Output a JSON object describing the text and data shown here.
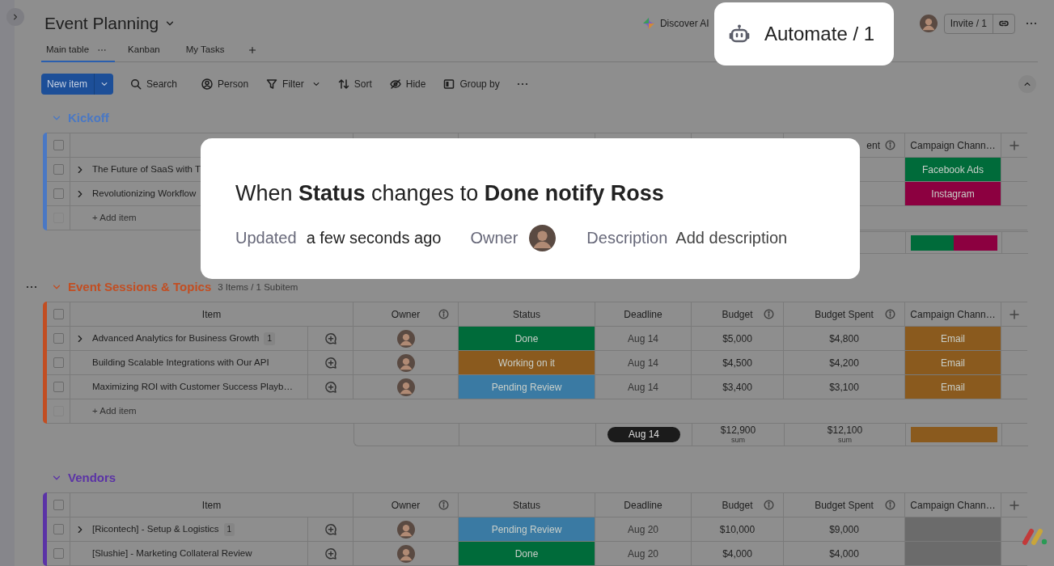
{
  "board": {
    "title": "Event Planning"
  },
  "views": [
    {
      "label": "Main table",
      "selected": true
    },
    {
      "label": "Kanban",
      "selected": false
    },
    {
      "label": "My Tasks",
      "selected": false
    }
  ],
  "header_actions": {
    "discover_ai": "Discover AI",
    "automate": "Automate / 1",
    "invite": "Invite / 1"
  },
  "toolbar": {
    "new_item": "New item",
    "tools": [
      {
        "kind": "search",
        "label": "Search"
      },
      {
        "kind": "person",
        "label": "Person"
      },
      {
        "kind": "filter",
        "label": "Filter"
      },
      {
        "kind": "sort",
        "label": "Sort"
      },
      {
        "kind": "hide",
        "label": "Hide"
      },
      {
        "kind": "group",
        "label": "Group by"
      }
    ]
  },
  "groups": [
    {
      "name": "Kickoff",
      "color": "#4a78c4",
      "hovered": false,
      "all_checked": false,
      "columns": [
        {
          "kind": "spent",
          "label": "ent",
          "info": true,
          "cut_start": true
        },
        {
          "kind": "channel",
          "label": "Campaign Chann…",
          "info": false
        }
      ],
      "rows": [
        {
          "item": "The Future of SaaS with T",
          "checked": false,
          "expandable": true,
          "channel": {
            "label": "Facebook Ads",
            "color": "#006b3a"
          }
        },
        {
          "item": "Revolutionizing Workflow",
          "checked": false,
          "expandable": true,
          "channel": {
            "label": "Instagram",
            "color": "#8c0040"
          }
        }
      ],
      "add_item": "+ Add item",
      "summary": {
        "channel_split": [
          {
            "color": "#006b3a"
          },
          {
            "color": "#8c0040"
          }
        ]
      }
    },
    {
      "name": "Event Sessions & Topics",
      "count": "3 Items / 1 Subitem",
      "color": "#c24e22",
      "hovered": true,
      "all_checked": false,
      "columns": [
        {
          "kind": "item",
          "label": "Item",
          "info": false
        },
        {
          "kind": "owner",
          "label": "Owner",
          "info": true
        },
        {
          "kind": "status",
          "label": "Status",
          "info": false
        },
        {
          "kind": "deadline",
          "label": "Deadline",
          "info": false
        },
        {
          "kind": "budget",
          "label": "Budget",
          "info": true
        },
        {
          "kind": "spent",
          "label": "Budget Spent",
          "info": true
        },
        {
          "kind": "channel",
          "label": "Campaign Chann…",
          "info": false
        }
      ],
      "rows": [
        {
          "item": "Advanced Analytics for Business Growth",
          "checked": false,
          "expandable": true,
          "subitems": "1",
          "chat": true,
          "status": {
            "label": "Done",
            "color": "#006b3a"
          },
          "deadline": "Aug 14",
          "budget": "$5,000",
          "spent": "$4,800",
          "channel": {
            "label": "Email",
            "color": "#8a5a1e"
          }
        },
        {
          "item": "Building Scalable Integrations with Our API",
          "checked": false,
          "expandable": false,
          "chat": true,
          "status": {
            "label": "Working on it",
            "color": "#8a5a1e"
          },
          "deadline": "Aug 14",
          "budget": "$4,500",
          "spent": "$4,200",
          "channel": {
            "label": "Email",
            "color": "#8a5a1e"
          }
        },
        {
          "item": "Maximizing ROI with Customer Success Playb…",
          "checked": false,
          "expandable": false,
          "chat": true,
          "status": {
            "label": "Pending Review",
            "color": "#3a7aa3"
          },
          "deadline": "Aug 14",
          "budget": "$3,400",
          "spent": "$3,100",
          "channel": {
            "label": "Email",
            "color": "#8a5a1e"
          }
        }
      ],
      "add_item": "+ Add item",
      "summary": {
        "deadline": "Aug 14",
        "budget": "$12,900",
        "budget_note": "sum",
        "spent": "$12,100",
        "spent_note": "sum",
        "channel_split": [
          {
            "color": "#8a5a1e"
          }
        ]
      }
    },
    {
      "name": "Vendors",
      "color": "#5b33a6",
      "hovered": false,
      "all_checked": false,
      "columns": [
        {
          "kind": "item",
          "label": "Item",
          "info": false
        },
        {
          "kind": "owner",
          "label": "Owner",
          "info": true
        },
        {
          "kind": "status",
          "label": "Status",
          "info": false
        },
        {
          "kind": "deadline",
          "label": "Deadline",
          "info": false
        },
        {
          "kind": "budget",
          "label": "Budget",
          "info": true
        },
        {
          "kind": "spent",
          "label": "Budget Spent",
          "info": true
        },
        {
          "kind": "channel",
          "label": "Campaign Chann…",
          "info": false
        }
      ],
      "rows": [
        {
          "item": "[Ricontech] - Setup & Logistics",
          "checked": false,
          "expandable": true,
          "subitems": "1",
          "chat": true,
          "status": {
            "label": "Pending Review",
            "color": "#3a7aa3"
          },
          "deadline": "Aug 20",
          "budget": "$10,000",
          "spent": "$9,000",
          "channel": {
            "color": "#6b6b6b"
          }
        },
        {
          "item": "[Slushie] - Marketing Collateral Review",
          "checked": false,
          "expandable": false,
          "chat": true,
          "status": {
            "label": "Done",
            "color": "#006b3a"
          },
          "deadline": "Aug 20",
          "budget": "$4,000",
          "spent": "$4,000",
          "channel": {
            "color": "#6b6b6b"
          }
        }
      ]
    }
  ],
  "automation_popup": {
    "sentence": "When **Status** changes to **Done notify Ross**",
    "updated_label": "Updated",
    "updated_value": "a few seconds ago",
    "owner_label": "Owner",
    "description_label": "Description",
    "description_value": "Add description"
  }
}
